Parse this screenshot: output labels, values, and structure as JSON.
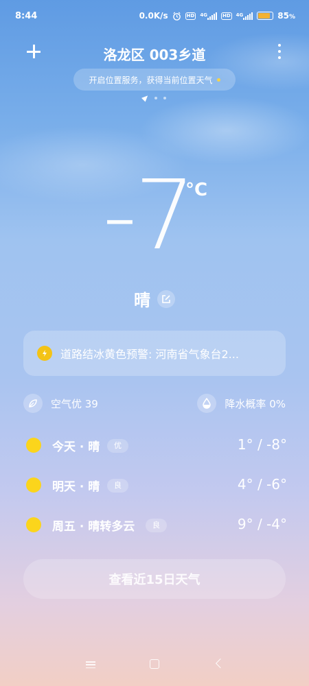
{
  "status_bar": {
    "time": "8:44",
    "net_speed": "0.0K/s",
    "hd1": "HD",
    "net1": "4G",
    "hd2": "HD",
    "net2": "4G",
    "battery_percent": "85",
    "battery_unit": "%",
    "battery_color": "#f2b233"
  },
  "header": {
    "title": "洛龙区 003乡道"
  },
  "location_banner": {
    "text": "开启位置服务，获得当前位置天气"
  },
  "current": {
    "temperature": "-7",
    "unit": "°C",
    "condition": "晴"
  },
  "alert": {
    "text": "道路结冰黄色预警: 河南省气象台2...",
    "color": "#f3c316"
  },
  "air": {
    "label": "空气优 39"
  },
  "precip": {
    "label": "降水概率 0%"
  },
  "forecast": [
    {
      "day": "今天 · 晴",
      "aqi": "优",
      "range": "1° / -8°"
    },
    {
      "day": "明天 · 晴",
      "aqi": "良",
      "range": "4° / -6°"
    },
    {
      "day": "周五 · 晴转多云",
      "aqi": "良",
      "range": "9° / -4°"
    }
  ],
  "button_15day": {
    "label": "查看近15日天气"
  },
  "icons": [
    "add-icon",
    "more-icon",
    "location-arrow-icon",
    "edit-icon",
    "alert-icon",
    "leaf-icon",
    "drop-icon",
    "sun-icon"
  ]
}
